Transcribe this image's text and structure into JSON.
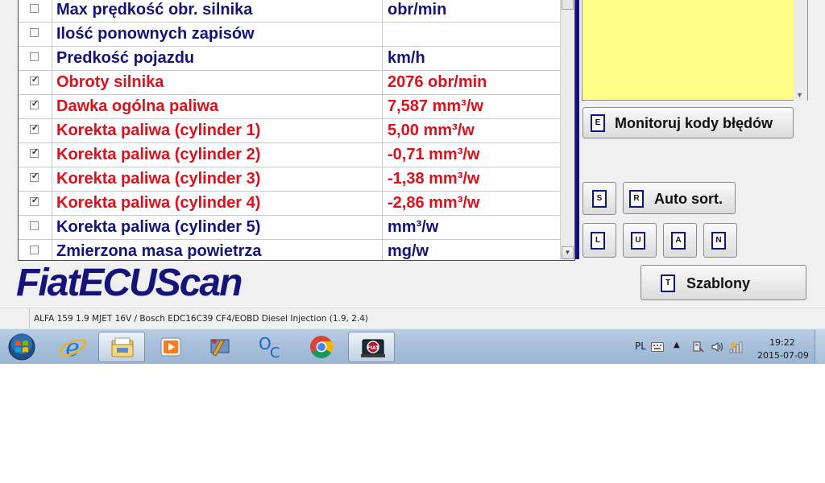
{
  "params": [
    {
      "checked": false,
      "name": "Max prędkość obr. silnika",
      "value": "obr/min"
    },
    {
      "checked": false,
      "name": "Ilość ponownych zapisów",
      "value": ""
    },
    {
      "checked": false,
      "name": "Predkość pojazdu",
      "value": "km/h"
    },
    {
      "checked": true,
      "name": "Obroty silnika",
      "value": "2076 obr/min"
    },
    {
      "checked": true,
      "name": "Dawka ogólna paliwa",
      "value": "7,587 mm³/w"
    },
    {
      "checked": true,
      "name": "Korekta paliwa (cylinder 1)",
      "value": "5,00 mm³/w"
    },
    {
      "checked": true,
      "name": "Korekta paliwa (cylinder 2)",
      "value": "-0,71 mm³/w"
    },
    {
      "checked": true,
      "name": "Korekta paliwa (cylinder 3)",
      "value": "-1,38 mm³/w"
    },
    {
      "checked": true,
      "name": "Korekta paliwa (cylinder 4)",
      "value": "-2,86 mm³/w"
    },
    {
      "checked": false,
      "name": "Korekta paliwa (cylinder 5)",
      "value": "mm³/w"
    },
    {
      "checked": false,
      "name": "Zmierzona masa powietrza",
      "value": "mg/w"
    }
  ],
  "logo": "FiatECUScan",
  "buttons": {
    "monitor": {
      "key": "E",
      "label": "Monitoruj kody błędów"
    },
    "s": {
      "key": "S"
    },
    "autosort": {
      "key": "R",
      "label": "Auto sort."
    },
    "l": {
      "key": "L"
    },
    "u": {
      "key": "U"
    },
    "a": {
      "key": "A"
    },
    "n": {
      "key": "N"
    },
    "templates": {
      "key": "T",
      "label": "Szablony"
    }
  },
  "status": {
    "text": "ALFA 159 1.9 MJET 16V / Bosch EDC16C39 CF4/EOBD Diesel Injection (1.9, 2.4)"
  },
  "taskbar": {
    "apps": [
      "windows-start",
      "internet-explorer",
      "windows-explorer",
      "media-player",
      "remote-desktop",
      "ocr-app",
      "chrome",
      "fiatecuscan"
    ],
    "lang": "PL",
    "time": "19:22",
    "date": "2015-07-09"
  },
  "colors": {
    "active_param": "#e0101a",
    "inactive_param": "#13137a",
    "monitor_area": "#ffff88",
    "logo": "#13137a"
  }
}
